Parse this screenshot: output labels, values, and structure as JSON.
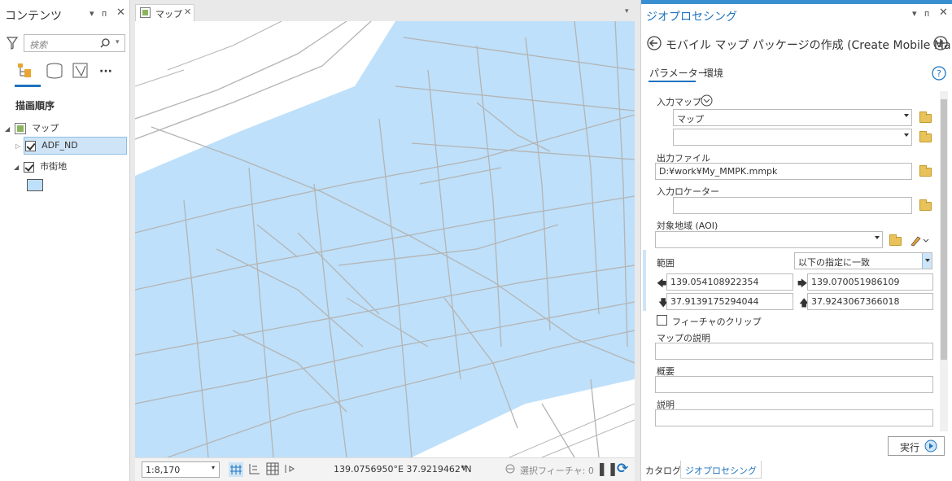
{
  "contents": {
    "title": "コンテンツ",
    "search_placeholder": "検索",
    "drawing_order": "描画順序",
    "tree": [
      {
        "label": "マップ"
      },
      {
        "label": "ADF_ND"
      },
      {
        "label": "市街地"
      }
    ]
  },
  "map": {
    "tab_label": "マップ",
    "scale": "1:8,170",
    "coordinates": "139.0756950°E 37.9219462°N",
    "selected_features": "選択フィーチャ: 0"
  },
  "gp": {
    "title": "ジオプロセシング",
    "tool_name": "モバイル マップ パッケージの作成 (Create Mobile Ma...",
    "tabs": [
      "パラメーター",
      "環境"
    ],
    "input_map_label": "入力マップ",
    "input_map_value": "マップ",
    "input_map_value2": "",
    "output_file_label": "出力ファイル",
    "output_file_value": "D:¥work¥My_MMPK.mmpk",
    "locator_label": "入力ロケーター",
    "locator_value": "",
    "aoi_label": "対象地域 (AOI)",
    "aoi_value": "",
    "extent_label": "範囲",
    "extent_option": "以下の指定に一致",
    "extent_left": "139.054108922354",
    "extent_right": "139.070051986109",
    "extent_bottom": "37.9139175294044",
    "extent_top": "37.9243067366018",
    "clip_label": "フィーチャのクリップ",
    "map_desc_label": "マップの説明",
    "summary_label": "概要",
    "description_label": "説明",
    "run_label": "実行",
    "bottom_tabs": [
      "カタログ",
      "ジオプロセシング"
    ]
  },
  "colors": {
    "accent": "#1e73be",
    "map_fill": "#bee0fa",
    "road": "#b4b4b4"
  }
}
